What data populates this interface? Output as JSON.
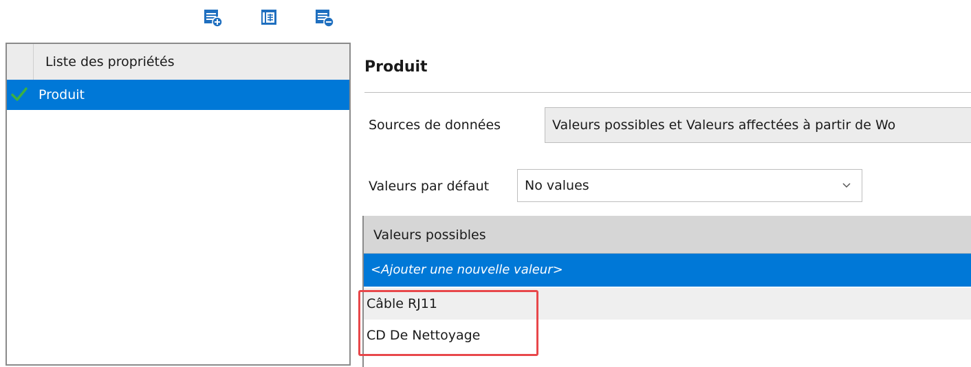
{
  "toolbar": {
    "buttons": [
      {
        "icon": "add-table-icon"
      },
      {
        "icon": "table-properties-icon"
      },
      {
        "icon": "remove-table-icon"
      }
    ]
  },
  "left_panel": {
    "header": "Liste des propriétés",
    "items": [
      {
        "label": "Produit",
        "selected": true,
        "icon": "check-icon"
      }
    ]
  },
  "detail": {
    "title": "Produit",
    "data_source_label": "Sources de données",
    "data_source_value": "Valeurs possibles et Valeurs affectées à partir de Wo",
    "default_values_label": "Valeurs par défaut",
    "default_values_value": "No values",
    "grid": {
      "header": "Valeurs possibles",
      "new_row": "<Ajouter une nouvelle valeur>",
      "rows": [
        "Câble RJ11",
        "CD De Nettoyage"
      ]
    }
  },
  "colors": {
    "selection": "#0078d7",
    "highlight": "#e8474a",
    "check": "#3cb043",
    "icon": "#1f6fbf"
  }
}
